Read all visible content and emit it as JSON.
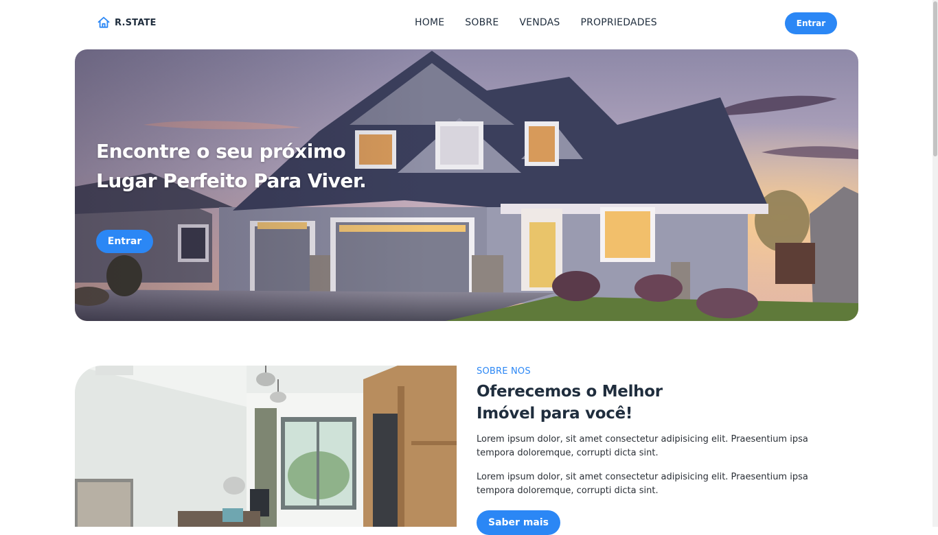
{
  "brand": {
    "name": "R.STATE",
    "icon": "home-icon",
    "accent": "#2b87f5"
  },
  "nav": {
    "items": [
      "HOME",
      "SOBRE",
      "VENDAS",
      "PROPRIEDADES"
    ],
    "login_label": "Entrar"
  },
  "hero": {
    "title": "Encontre o seu próximo Lugar Perfeito Para Viver.",
    "cta_label": "Entrar"
  },
  "about": {
    "kicker": "SOBRE NOS",
    "title_line1": "Oferecemos o Melhor",
    "title_line2": "Imóvel para você!",
    "paragraph1": "Lorem ipsum dolor, sit amet consectetur adipisicing elit. Praesentium ipsa tempora doloremque, corrupti dicta sint.",
    "paragraph2": "Lorem ipsum dolor, sit amet consectetur adipisicing elit. Praesentium ipsa tempora doloremque, corrupti dicta sint.",
    "cta_label": "Saber mais"
  }
}
